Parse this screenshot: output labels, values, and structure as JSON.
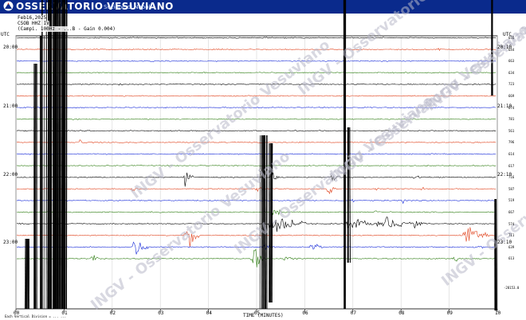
{
  "header": {
    "title": "OSSERVATORIO VESUVIANO",
    "subtitle": "Sezione di Napoli"
  },
  "info": {
    "date": "Feb16,2025",
    "station": "CSOB HHZ IV",
    "params": "(Campi. 100Hz - ...B  - Gain 0.004)"
  },
  "axes": {
    "left_utc": "UTC",
    "right_utc": "UTC",
    "left_times": [
      "20:00",
      "21:00",
      "22:00",
      "23:00"
    ],
    "right_times": [
      "20:10",
      "21:10",
      "22:10",
      "23:10"
    ],
    "x_ticks": [
      "00",
      "01",
      "02",
      "03",
      "04",
      "05",
      "06",
      "07",
      "08",
      "09",
      "10"
    ],
    "x_label": "TIME (MINUTES)",
    "right_values": [
      "655",
      "644",
      "663",
      "634",
      "723",
      "669",
      "674",
      "781",
      "561",
      "796",
      "614",
      "617",
      "716",
      "587",
      "519",
      "667",
      "574",
      "711",
      "639",
      "613"
    ],
    "bottom_value": "-28153.0",
    "footer": "Each Vertical Division = ... ..."
  },
  "watermark": "INGV - Osservatorio Vesuviano",
  "colors": {
    "header_bg": "#0a2a8c",
    "black": "#000000",
    "red": "#e0401a",
    "blue": "#1428d8",
    "green": "#2e7d12",
    "grid": "#d6d6d6",
    "watermark": "#b8b8c8"
  }
}
